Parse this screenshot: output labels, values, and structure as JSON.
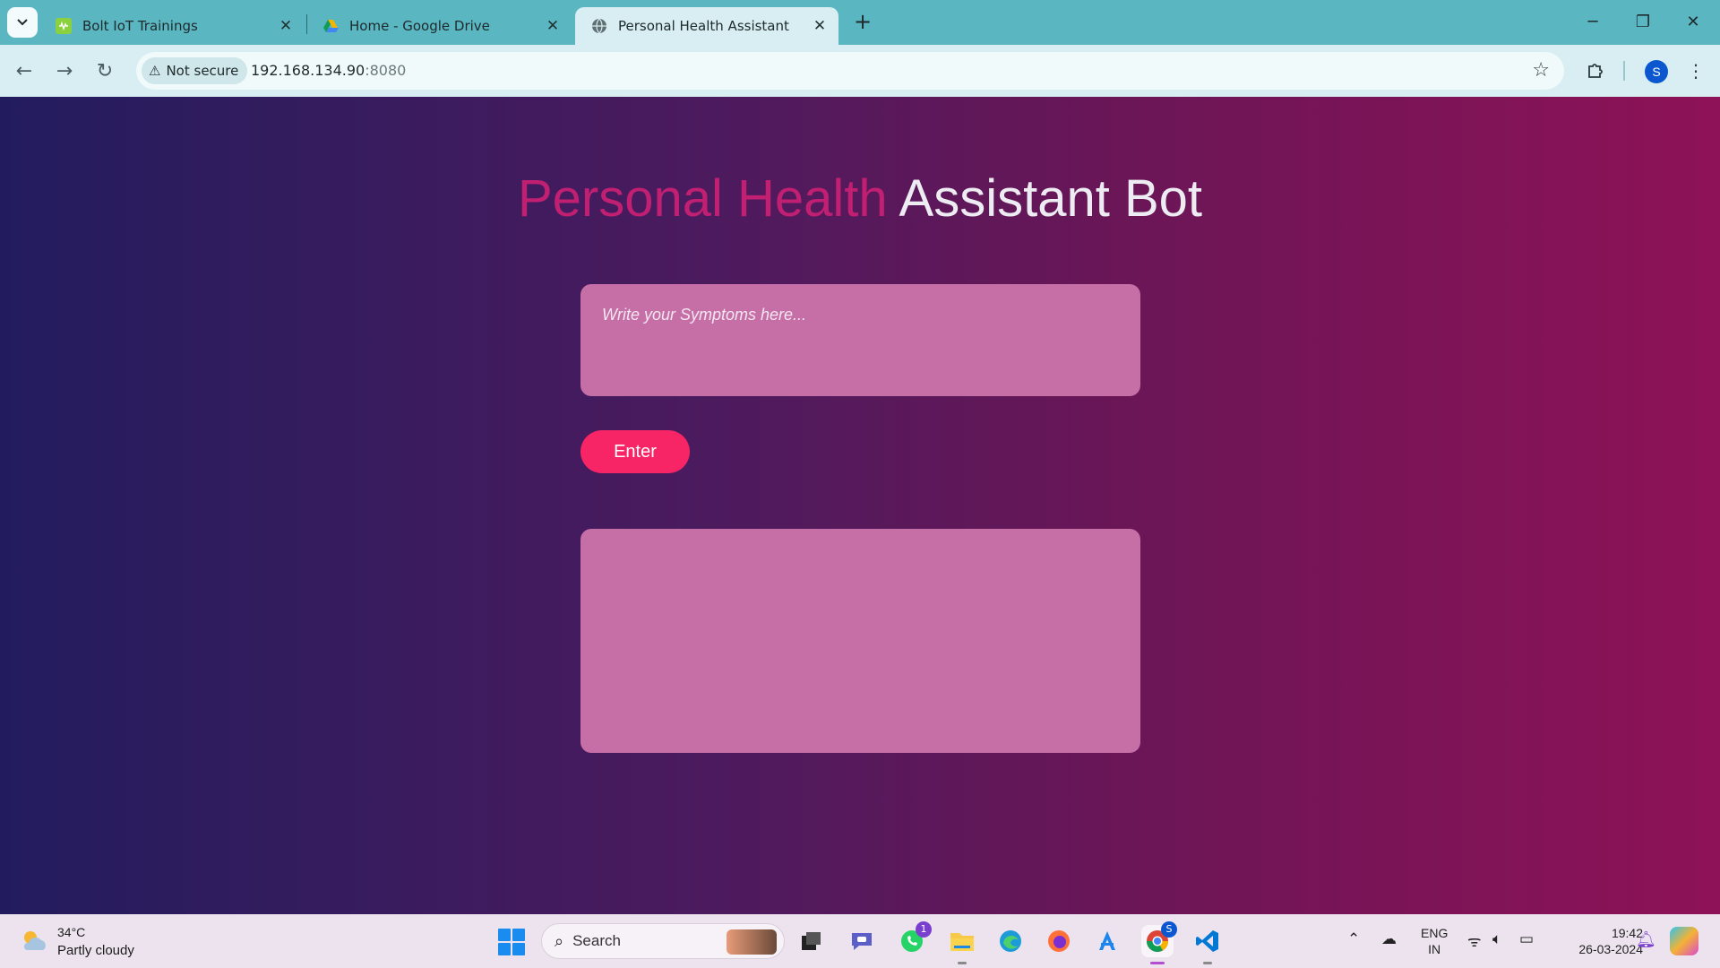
{
  "browser": {
    "tabs": [
      {
        "title": "Bolt IoT Trainings",
        "icon": "bolt-favicon",
        "active": false
      },
      {
        "title": "Home - Google Drive",
        "icon": "google-drive-icon",
        "active": false
      },
      {
        "title": "Personal Health Assistant",
        "icon": "globe-icon",
        "active": true
      }
    ],
    "security_label": "Not secure",
    "url_host": "192.168.134.90",
    "url_port": ":8080",
    "profile_initial": "S"
  },
  "page": {
    "heading_accent": "Personal Health",
    "heading_rest": " Assistant Bot",
    "symptoms_placeholder": "Write your Symptoms here...",
    "symptoms_value": "",
    "enter_label": "Enter",
    "output_text": ""
  },
  "taskbar": {
    "temperature": "34°C",
    "weather": "Partly cloudy",
    "search_placeholder": "Search",
    "whatsapp_badge": "1",
    "chrome_badge": "S",
    "lang_line1": "ENG",
    "lang_line2": "IN",
    "time": "19:42",
    "date": "26-03-2024"
  },
  "colors": {
    "accent": "#c11f72",
    "button": "#f72565",
    "panel": "#c56fa6"
  }
}
